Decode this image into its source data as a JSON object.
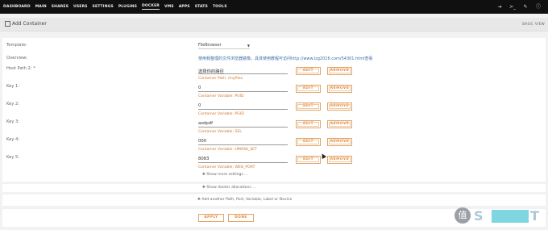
{
  "nav": {
    "items": [
      "DASHBOARD",
      "MAIN",
      "SHARES",
      "USERS",
      "SETTINGS",
      "PLUGINS",
      "DOCKER",
      "VMS",
      "APPS",
      "STATS",
      "TOOLS"
    ],
    "active": "DOCKER"
  },
  "header": {
    "title": "Add Container",
    "view_toggle": "BASIC VIEW"
  },
  "form": {
    "template_label": "Template:",
    "template_value": "FileBrowser",
    "overview_label": "Overview:",
    "overview_text": "使用我整理的文件浏览器镜像。具体使用教程可访问http://www.lzg2016.com/54301.html查看",
    "fields": [
      {
        "label": "Host Path 2: *",
        "value": "选择你的路径",
        "hint": "Container Path: /myfiles"
      },
      {
        "label": "Key 1:",
        "value": "0",
        "hint": "Container Variable: PUID"
      },
      {
        "label": "Key 2:",
        "value": "0",
        "hint": "Container Variable: PGID"
      },
      {
        "label": "Key 3:",
        "value": "asdpdf",
        "hint": "Container Variable: SSL"
      },
      {
        "label": "Key 4:",
        "value": "000",
        "hint": "Container Variable: UMASK_SET"
      },
      {
        "label": "Key 5:",
        "value": "8083",
        "hint": "Container Variable: WEB_PORT"
      }
    ],
    "edit_label": "EDIT",
    "remove_label": "REMOVE",
    "show_more": "✚ Show more settings ..."
  },
  "allocations": "✚ Show docker allocations ...",
  "add_another": "✚ Add another Path, Port, Variable, Label or Device",
  "actions": {
    "apply": "APPLY",
    "done": "DONE"
  },
  "watermark": {
    "glyph": "值",
    "text": "S"
  },
  "colors": {
    "accent": "#e08a3c",
    "hint": "#d1762a",
    "link": "#3e6ea8",
    "nav_bg": "#101010"
  }
}
